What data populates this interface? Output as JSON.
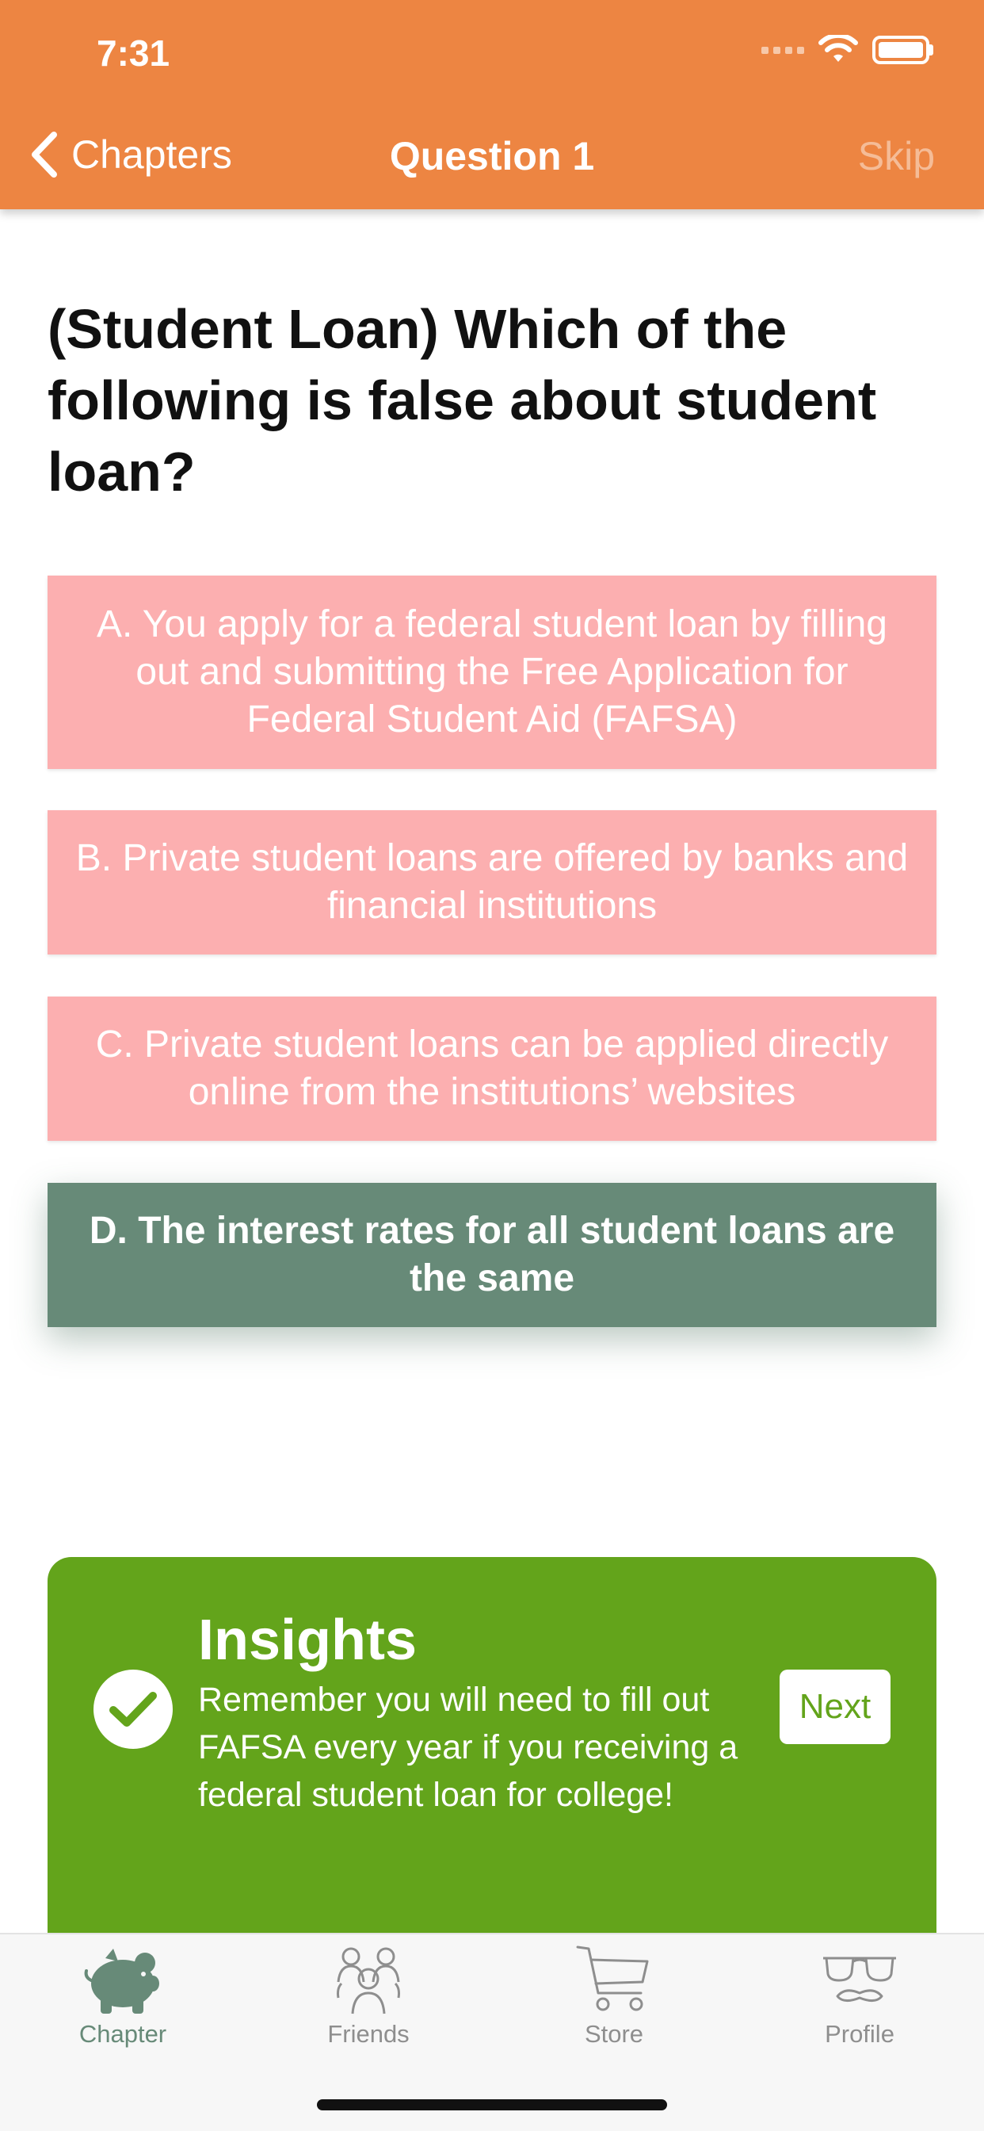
{
  "status_bar": {
    "time": "7:31"
  },
  "nav": {
    "back_label": "Chapters",
    "title": "Question 1",
    "skip_label": "Skip"
  },
  "question": {
    "text": "(Student Loan) Which of the following is false about student loan?"
  },
  "answers": [
    {
      "text": "A. You apply for a federal student loan by filling out and submitting the Free Application for Federal Student Aid (FAFSA)",
      "state": "wrong"
    },
    {
      "text": "B. Private student loans are offered by banks and financial institutions",
      "state": "wrong"
    },
    {
      "text": "C. Private student loans can be applied directly online from the institutions’ websites",
      "state": "wrong"
    },
    {
      "text": "D. The interest rates for all student loans are the same",
      "state": "correct"
    }
  ],
  "insights": {
    "title": "Insights",
    "body": "Remember you will need to fill out FAFSA every year if you receiving a federal student loan for college!",
    "next_label": "Next"
  },
  "tabs": [
    {
      "label": "Chapter",
      "icon": "piggy-bank-icon",
      "active": true
    },
    {
      "label": "Friends",
      "icon": "friends-icon",
      "active": false
    },
    {
      "label": "Store",
      "icon": "cart-icon",
      "active": false
    },
    {
      "label": "Profile",
      "icon": "glasses-mustache-icon",
      "active": false
    }
  ],
  "colors": {
    "header": "#ED8542",
    "wrong_answer": "#FCAFB0",
    "correct_answer": "#678A78",
    "insights": "#63A41B",
    "tab_active": "#678A78",
    "tab_inactive": "#8E8E8E"
  }
}
